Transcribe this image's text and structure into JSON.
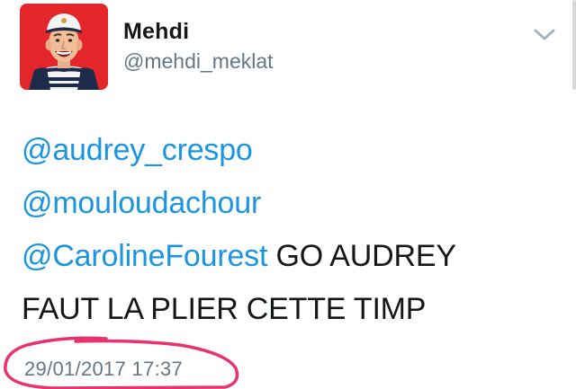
{
  "user": {
    "display_name": "Mehdi",
    "handle": "@mehdi_meklat"
  },
  "tweet": {
    "mentions": [
      "@audrey_crespo",
      "@mouloudachour",
      "@CarolineFourest"
    ],
    "text_after_mentions": " GO AUDREY",
    "text_line_2": "FAUT LA PLIER CETTE TIMP",
    "timestamp": "29/01/2017 17:37"
  },
  "icons": {
    "menu": "chevron-down-icon",
    "avatar": "profile-photo"
  },
  "colors": {
    "mention": "#1b95e0",
    "text": "#14171a",
    "secondary": "#657786",
    "avatar_background": "#e4262b",
    "annotation": "#e8336f"
  }
}
